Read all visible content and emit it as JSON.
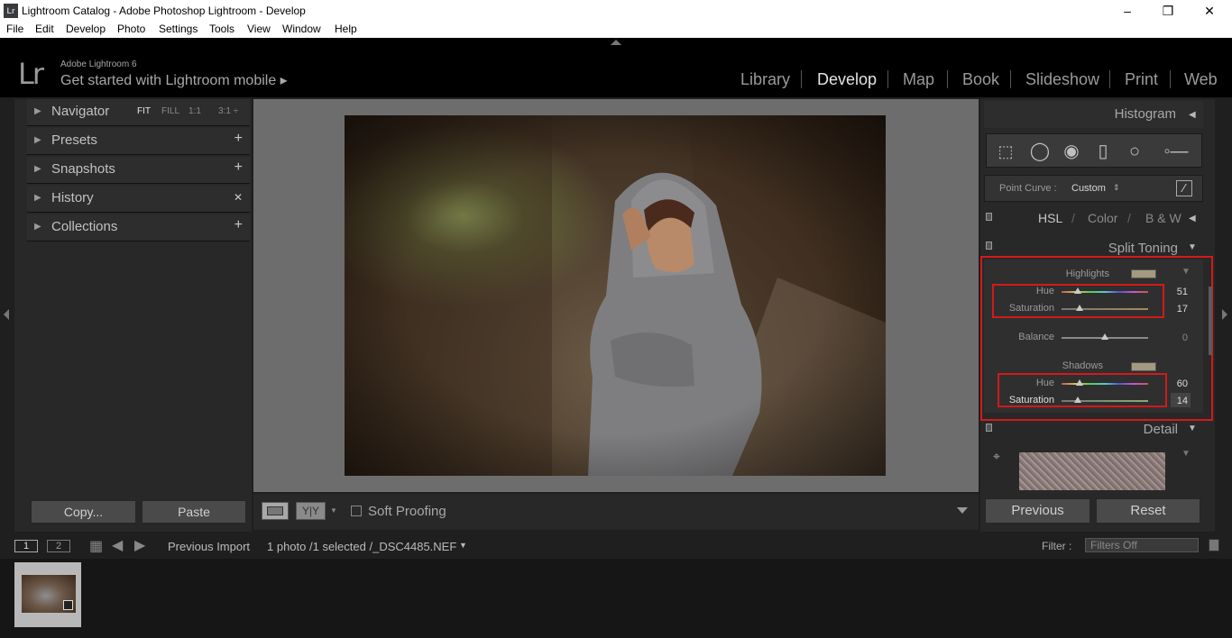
{
  "window": {
    "title": "Lightroom Catalog - Adobe Photoshop Lightroom - Develop",
    "icon": "Lr",
    "minimize": "–",
    "restore": "❐",
    "close": "✕"
  },
  "menu": [
    "File",
    "Edit",
    "Develop",
    "Photo",
    "Settings",
    "Tools",
    "View",
    "Window",
    "Help"
  ],
  "identity": {
    "logo": "Lr",
    "product": "Adobe Lightroom 6",
    "mobile": "Get started with Lightroom mobile  ▸"
  },
  "modules": [
    "Library",
    "Develop",
    "Map",
    "Book",
    "Slideshow",
    "Print",
    "Web"
  ],
  "active_module": "Develop",
  "left_panel": {
    "navigator": {
      "label": "Navigator",
      "options": [
        "FIT",
        "FILL",
        "1:1",
        "3:1 ÷"
      ]
    },
    "sections": [
      {
        "label": "Presets",
        "action": "+"
      },
      {
        "label": "Snapshots",
        "action": "+"
      },
      {
        "label": "History",
        "action": "✕"
      },
      {
        "label": "Collections",
        "action": "+"
      }
    ],
    "copy": "Copy...",
    "paste": "Paste"
  },
  "toolbar": {
    "soft_proofing": "Soft Proofing",
    "yy": "Y|Y"
  },
  "right_panel": {
    "histogram": "Histogram",
    "point_curve_label": "Point Curve :",
    "point_curve_value": "Custom",
    "hsl": "HSL",
    "color": "Color",
    "bw": "B & W",
    "split_toning": "Split Toning",
    "highlights": {
      "label": "Highlights",
      "hue_label": "Hue",
      "hue": 51,
      "sat_label": "Saturation",
      "sat": 17
    },
    "balance": {
      "label": "Balance",
      "value": 0
    },
    "shadows": {
      "label": "Shadows",
      "hue_label": "Hue",
      "hue": 60,
      "sat_label": "Saturation",
      "sat": 14
    },
    "detail": "Detail",
    "previous": "Previous",
    "reset": "Reset"
  },
  "filmstrip": {
    "view1": "1",
    "view2": "2",
    "source": "Previous Import",
    "info": "1 photo /1 selected /_DSC4485.NEF",
    "filter_label": "Filter :",
    "filter_value": "Filters Off"
  },
  "colors": {
    "highlight_red": "#d31a1a",
    "panel_bg": "#282828",
    "center_bg": "#6d6d6d"
  }
}
